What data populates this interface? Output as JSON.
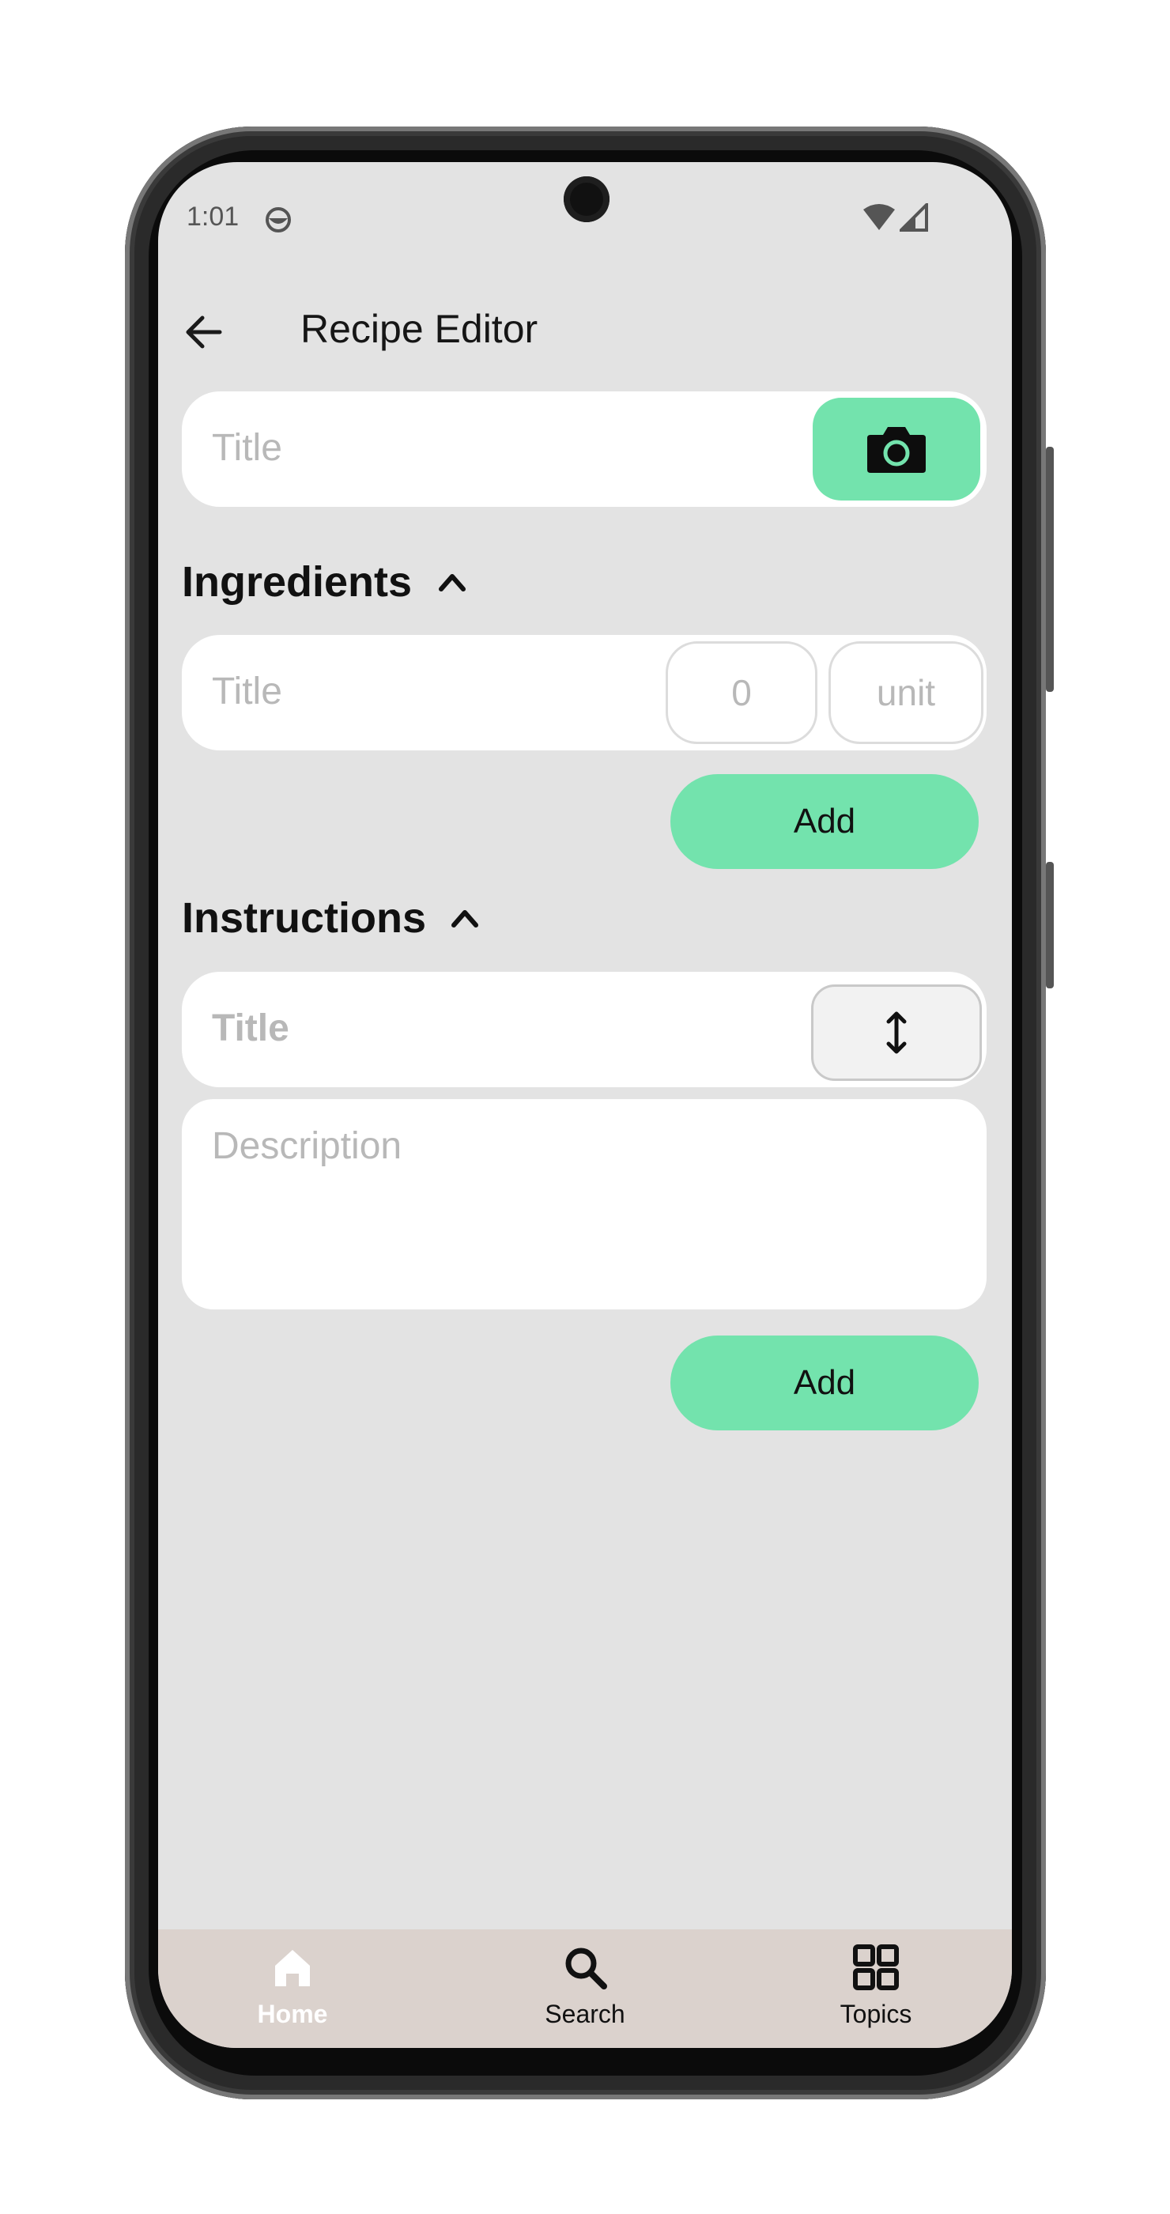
{
  "status_bar": {
    "time": "1:01"
  },
  "topbar": {
    "title": "Recipe Editor",
    "back_icon": "arrow-left-icon"
  },
  "recipe": {
    "title_placeholder": "Title",
    "camera_icon": "camera-icon"
  },
  "ingredients": {
    "heading": "Ingredients",
    "title_placeholder": "Title",
    "quantity_placeholder": "0",
    "unit_placeholder": "unit",
    "add_label": "Add"
  },
  "instructions": {
    "heading": "Instructions",
    "title_placeholder": "Title",
    "description_placeholder": "Description",
    "add_label": "Add"
  },
  "bottom_nav": {
    "items": [
      {
        "label": "Home",
        "icon": "home-icon",
        "active": true
      },
      {
        "label": "Search",
        "icon": "search-icon",
        "active": false
      },
      {
        "label": "Topics",
        "icon": "grid-icon",
        "active": false
      }
    ]
  },
  "colors": {
    "accent": "#73e3ad",
    "screen_bg": "#e3e3e3",
    "nav_bg": "#dbd2cd"
  }
}
